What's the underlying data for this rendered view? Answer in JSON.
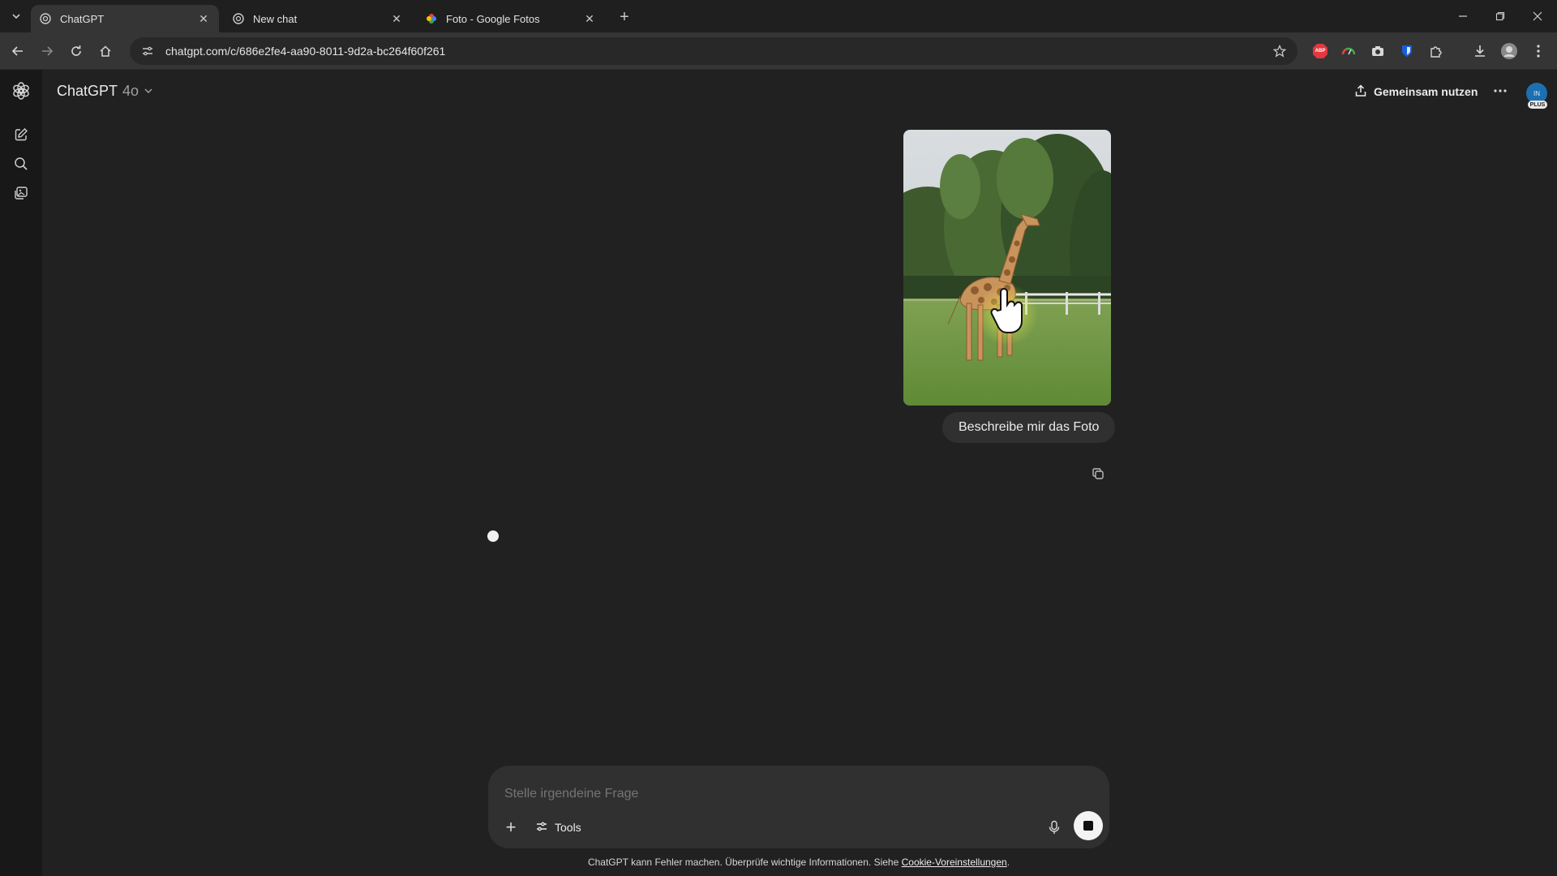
{
  "browser": {
    "tabs": [
      {
        "title": "ChatGPT",
        "active": true,
        "favicon": "chatgpt-icon"
      },
      {
        "title": "New chat",
        "active": false,
        "favicon": "chatgpt-icon"
      },
      {
        "title": "Foto - Google Fotos",
        "active": false,
        "favicon": "google-photos-icon"
      }
    ],
    "url": "chatgpt.com/c/686e2fe4-aa90-8011-9d2a-bc264f60f261",
    "extensions": [
      "abp-icon",
      "gauge-icon",
      "camera-icon",
      "bitwarden-icon",
      "puzzle-icon"
    ],
    "abp_label": "ABP"
  },
  "header": {
    "app_name": "ChatGPT",
    "model": "4o",
    "share_label": "Gemeinsam nutzen",
    "avatar_initials": "IN",
    "plan_badge": "PLUS"
  },
  "conversation": {
    "user_image_subject": "giraffe-photo",
    "user_message": "Beschreibe mir das Foto"
  },
  "composer": {
    "placeholder": "Stelle irgendeine Frage",
    "tools_label": "Tools"
  },
  "footer": {
    "text": "ChatGPT kann Fehler machen. Überprüfe wichtige Informationen. Siehe ",
    "link": "Cookie-Voreinstellungen",
    "suffix": "."
  },
  "colors": {
    "background": "#212121",
    "tabbar": "#1f1f1f",
    "toolbar": "#353535",
    "sidebar": "#181818",
    "bubble": "#303030",
    "avatar": "#1c6fb0"
  }
}
